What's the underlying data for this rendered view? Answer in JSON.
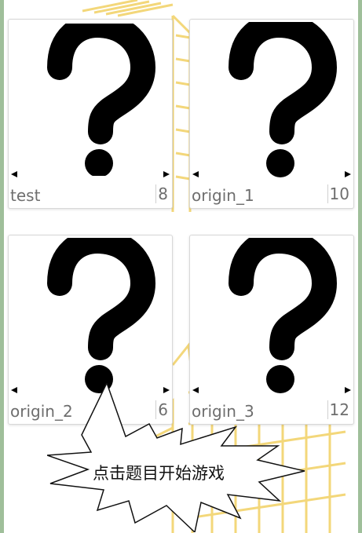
{
  "puzzles": [
    {
      "title": "test",
      "count": "8"
    },
    {
      "title": "origin_1",
      "count": "10"
    },
    {
      "title": "origin_2",
      "count": "6"
    },
    {
      "title": "origin_3",
      "count": "12"
    }
  ],
  "hint": {
    "text": "点击题目开始游戏"
  },
  "colors": {
    "grid": "#f3d77a",
    "frame": "#9fbf9a"
  }
}
